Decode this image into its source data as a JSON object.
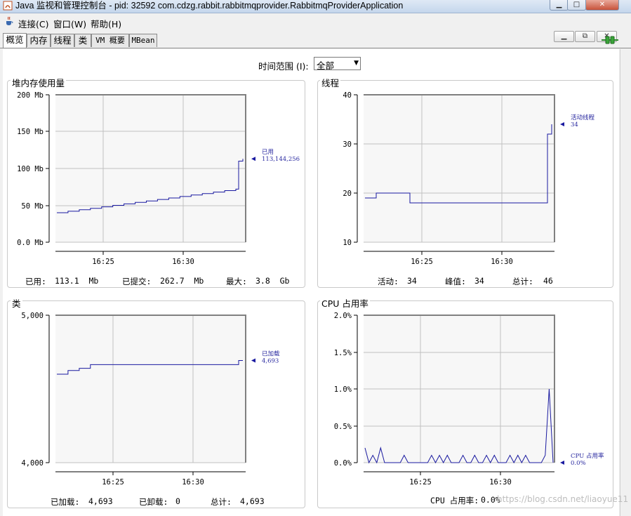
{
  "window": {
    "title": "Java 监视和管理控制台 - pid: 32592 com.cdzg.rabbit.rabbitmqprovider.RabbitmqProviderApplication",
    "min_glyph": "▁",
    "max_glyph": "□",
    "close_glyph": "✕"
  },
  "menu": {
    "connect": "连接(C)",
    "window": "窗口(W)",
    "help": "帮助(H)"
  },
  "inner_buttons": {
    "min": "▁",
    "max": "⧉",
    "close": "✕"
  },
  "tabs": [
    "概览",
    "内存",
    "线程",
    "类",
    "VM 概要",
    "MBean"
  ],
  "time_range": {
    "label": "时间范围 (I):",
    "value": "全部",
    "arrow": "▼"
  },
  "x_ticks": [
    "16:25",
    "16:30"
  ],
  "panels": {
    "heap": {
      "title": "堆内存使用量",
      "y_ticks": [
        "200 Mb",
        "150 Mb",
        "100 Mb",
        "50 Mb",
        "0.0 Mb"
      ],
      "legend_name": "已用",
      "legend_value": "113,144,256",
      "stats": [
        {
          "label": "已用:",
          "value": "113.1  Mb"
        },
        {
          "label": "已提交:",
          "value": "262.7  Mb"
        },
        {
          "label": "最大:",
          "value": "3.8  Gb"
        }
      ]
    },
    "threads": {
      "title": "线程",
      "y_ticks": [
        "40",
        "30",
        "20",
        "10"
      ],
      "legend_name": "活动线程",
      "legend_value": "34",
      "stats": [
        {
          "label": "活动:",
          "value": "34"
        },
        {
          "label": "峰值:",
          "value": "34"
        },
        {
          "label": "总计:",
          "value": "46"
        }
      ]
    },
    "classes": {
      "title": "类",
      "y_ticks": [
        "5,000",
        "4,000"
      ],
      "legend_name": "已加载",
      "legend_value": "4,693",
      "stats": [
        {
          "label": "已加载:",
          "value": "4,693"
        },
        {
          "label": "已卸载:",
          "value": "0"
        },
        {
          "label": "总计:",
          "value": "4,693"
        }
      ]
    },
    "cpu": {
      "title": "CPU 占用率",
      "y_ticks": [
        "2.0%",
        "1.5%",
        "1.0%",
        "0.5%",
        "0.0%"
      ],
      "legend_name": "CPU 占用率",
      "legend_value": "0.0%",
      "stats": [
        {
          "label": "CPU 占用率:",
          "value": "0.0%"
        }
      ]
    }
  },
  "watermark": "https://blog.csdn.net/liaoyue11",
  "colors": {
    "series": "#1a1aa0",
    "plot_bg": "#f7f7f7",
    "grid": "#c0c0c0"
  },
  "chart_data": [
    {
      "type": "line",
      "title": "堆内存使用量",
      "ylabel": "Mb",
      "ylim": [
        0,
        200
      ],
      "x_ticks": [
        "16:25",
        "16:30"
      ],
      "series": [
        {
          "name": "已用",
          "values": [
            40,
            42,
            44,
            46,
            48,
            50,
            52,
            54,
            56,
            58,
            60,
            62,
            64,
            66,
            68,
            70,
            72,
            110,
            113.1
          ]
        }
      ]
    },
    {
      "type": "line",
      "title": "线程",
      "ylim": [
        10,
        40
      ],
      "x_ticks": [
        "16:25",
        "16:30"
      ],
      "series": [
        {
          "name": "活动线程",
          "values": [
            19,
            20,
            20,
            20,
            18,
            18,
            18,
            18,
            18,
            18,
            18,
            18,
            18,
            18,
            18,
            18,
            18,
            32,
            34
          ]
        }
      ]
    },
    {
      "type": "line",
      "title": "类",
      "ylim": [
        4000,
        5000
      ],
      "x_ticks": [
        "16:25",
        "16:30"
      ],
      "series": [
        {
          "name": "已加载",
          "values": [
            4600,
            4625,
            4640,
            4665,
            4665,
            4665,
            4665,
            4665,
            4665,
            4665,
            4665,
            4665,
            4665,
            4665,
            4665,
            4665,
            4665,
            4693,
            4693
          ]
        }
      ]
    },
    {
      "type": "line",
      "title": "CPU 占用率",
      "ylabel": "%",
      "ylim": [
        0,
        2.0
      ],
      "x_ticks": [
        "16:25",
        "16:30"
      ],
      "series": [
        {
          "name": "CPU 占用率",
          "values": [
            0.2,
            0,
            0.1,
            0,
            0.2,
            0,
            0,
            0,
            0,
            0,
            0.1,
            0,
            0,
            0,
            0,
            0,
            0,
            0.1,
            0,
            0.1,
            0,
            0.1,
            0,
            0,
            0,
            0.1,
            0,
            0,
            0.1,
            0,
            0,
            0.1,
            0,
            0.1,
            0,
            0,
            0,
            0.1,
            0,
            0.1,
            0,
            0.1,
            0,
            0,
            0,
            0,
            0.1,
            1.0,
            0
          ]
        }
      ]
    }
  ]
}
